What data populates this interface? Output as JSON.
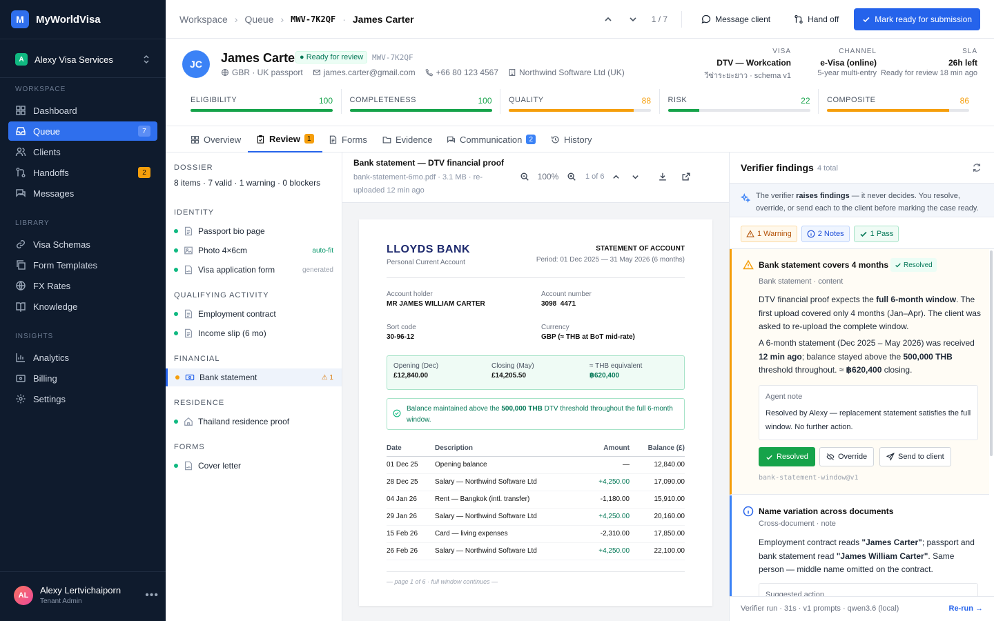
{
  "brand": {
    "logo": "M",
    "name": "MyWorldVisa"
  },
  "tenant": {
    "badge": "A",
    "name": "Alexy Visa Services"
  },
  "sidebar": {
    "workspace_label": "WORKSPACE",
    "workspace": [
      {
        "label": "Dashboard",
        "icon": "dashboard-icon"
      },
      {
        "label": "Queue",
        "icon": "inbox-icon",
        "count": "7"
      },
      {
        "label": "Clients",
        "icon": "users-icon"
      },
      {
        "label": "Handoffs",
        "icon": "handoff-icon",
        "count": "2"
      },
      {
        "label": "Messages",
        "icon": "messages-icon"
      }
    ],
    "library_label": "LIBRARY",
    "library": [
      {
        "label": "Visa Schemas"
      },
      {
        "label": "Form Templates"
      },
      {
        "label": "FX Rates"
      },
      {
        "label": "Knowledge"
      }
    ],
    "insights_label": "INSIGHTS",
    "insights": [
      {
        "label": "Analytics"
      },
      {
        "label": "Billing"
      },
      {
        "label": "Settings"
      }
    ]
  },
  "user": {
    "initials": "AL",
    "name": "Alexy Lertvichaiporn",
    "role": "Tenant Admin",
    "more": "•••"
  },
  "topbar": {
    "crumbs": [
      "Workspace",
      "Queue"
    ],
    "code": "MWV-7K2QF",
    "sep": "·",
    "client": "James Carter",
    "pager": "1 / 7",
    "message": "Message client",
    "handoff": "Hand off",
    "primary": "Mark ready for submission"
  },
  "client": {
    "initials": "JC",
    "name": "James Carter",
    "status": "Ready for review",
    "code": "MWV-7K2QF",
    "nationality": "GBR · UK passport",
    "email": "james.carter@gmail.com",
    "phone": "+66 80 123 4567",
    "employer": "Northwind Software Ltd (UK)",
    "visa": {
      "label": "VISA",
      "v1": "DTV — Workcation",
      "v2": "วีซ่าระยะยาว · schema v1"
    },
    "channel": {
      "label": "CHANNEL",
      "v1": "e-Visa (online)",
      "v2": "5-year multi-entry"
    },
    "sla": {
      "label": "SLA",
      "v1": "26h left",
      "v2": "Ready for review 18 min ago"
    },
    "scores": [
      {
        "label": "ELIGIBILITY",
        "value": 100,
        "color": "#16a34a"
      },
      {
        "label": "COMPLETENESS",
        "value": 100,
        "color": "#16a34a"
      },
      {
        "label": "QUALITY",
        "value": 88,
        "color": "#f59e0b"
      },
      {
        "label": "RISK",
        "value": 22,
        "color": "#16a34a"
      },
      {
        "label": "COMPOSITE",
        "value": 86,
        "color": "#f59e0b"
      }
    ]
  },
  "tabs": [
    {
      "label": "Overview"
    },
    {
      "label": "Review",
      "badge": "1"
    },
    {
      "label": "Forms"
    },
    {
      "label": "Evidence"
    },
    {
      "label": "Communication",
      "badge": "2"
    },
    {
      "label": "History"
    }
  ],
  "dossier": {
    "label": "DOSSIER",
    "summary": "8 items · 7 valid · 1 warning · 0 blockers",
    "groups": [
      {
        "label": "IDENTITY",
        "items": [
          {
            "label": "Passport bio page"
          },
          {
            "label": "Photo 4×6cm",
            "tag": "auto-fit"
          },
          {
            "label": "Visa application form",
            "tag": "generated"
          }
        ]
      },
      {
        "label": "QUALIFYING ACTIVITY",
        "items": [
          {
            "label": "Employment contract"
          },
          {
            "label": "Income slip (6 mo)"
          }
        ]
      },
      {
        "label": "FINANCIAL",
        "items": [
          {
            "label": "Bank statement",
            "tag": "⚠ 1"
          }
        ]
      },
      {
        "label": "RESIDENCE",
        "items": [
          {
            "label": "Thailand residence proof"
          }
        ]
      },
      {
        "label": "FORMS",
        "items": [
          {
            "label": "Cover letter"
          }
        ]
      }
    ]
  },
  "viewer": {
    "title": "Bank statement — DTV financial proof",
    "sub": "bank-statement-6mo.pdf · 3.1 MB · re-uploaded 12 min ago",
    "zoom": "100%",
    "page": "1 of 6",
    "doc": {
      "bank": "LLOYDS BANK",
      "account_type": "Personal Current Account",
      "heading": "STATEMENT OF ACCOUNT",
      "period": "Period: 01 Dec 2025 — 31 May 2026 (6 months)",
      "holder_k": "Account holder",
      "holder_v": "MR JAMES WILLIAM CARTER",
      "number_k": "Account number",
      "number_v": "3098  4471",
      "sort_k": "Sort code",
      "sort_v": "30-96-12",
      "currency_k": "Currency",
      "currency_v": "GBP (≈ THB at BoT mid-rate)",
      "opening_k": "Opening (Dec)",
      "opening_v": "£12,840.00",
      "closing_k": "Closing (May)",
      "closing_v": "£14,205.50",
      "thb_k": "≈ THB equivalent",
      "thb_v": "฿620,400",
      "note_a": "Balance maintained above the ",
      "note_b": "500,000 THB",
      "note_c": " DTV threshold throughout the full 6-month window.",
      "columns": [
        "Date",
        "Description",
        "Amount",
        "Balance (£)"
      ],
      "rows": [
        [
          "01 Dec 25",
          "Opening balance",
          "—",
          "12,840.00"
        ],
        [
          "28 Dec 25",
          "Salary — Northwind Software Ltd",
          "+4,250.00",
          "17,090.00"
        ],
        [
          "04 Jan 26",
          "Rent — Bangkok (intl. transfer)",
          "-1,180.00",
          "15,910.00"
        ],
        [
          "29 Jan 26",
          "Salary — Northwind Software Ltd",
          "+4,250.00",
          "20,160.00"
        ],
        [
          "15 Feb 26",
          "Card — living expenses",
          "-2,310.00",
          "17,850.00"
        ],
        [
          "26 Feb 26",
          "Salary — Northwind Software Ltd",
          "+4,250.00",
          "22,100.00"
        ]
      ],
      "footer": "— page 1 of 6 · full window continues —"
    }
  },
  "findings": {
    "title": "Verifier findings",
    "count": "4 total",
    "info_a": "The verifier ",
    "info_b": "raises findings",
    "info_c": " — it never decides. You resolve, override, or send each to the client before marking the case ready.",
    "chips": {
      "warning": "1 Warning",
      "notes": "2 Notes",
      "pass": "1 Pass"
    },
    "card1": {
      "title": "Bank statement covers 4 months",
      "badge": "Resolved",
      "sub": "Bank statement · content",
      "p1a": "DTV financial proof expects the ",
      "p1b": "full 6-month window",
      "p1c": ". The first upload covered only 4 months (Jan–Apr). The client was asked to re-upload the complete window.",
      "p2a": "A 6-month statement (Dec 2025 – May 2026) was received ",
      "p2b": "12 min ago",
      "p2c": "; balance stayed above the ",
      "p2d": "500,000 THB",
      "p2e": " threshold throughout. ≈ ",
      "p2f": "฿620,400",
      "p2g": " closing.",
      "agent_k": "Agent note",
      "agent_v": "Resolved by Alexy — replacement statement satisfies the full window. No further action.",
      "resolved": "Resolved",
      "override": "Override",
      "send": "Send to client",
      "rule": "bank-statement-window@v1"
    },
    "card2": {
      "title": "Name variation across documents",
      "sub": "Cross-document · note",
      "pa": "Employment contract reads ",
      "pb": "\"James Carter\"",
      "pc": "; passport and bank statement read ",
      "pd": "\"James William Carter\"",
      "pe": ". Same person — middle name omitted on the contract.",
      "sugg_k": "Suggested action"
    },
    "footer": "Verifier run · 31s · v1 prompts · qwen3.6 (local)",
    "rerun": "Re-run →"
  }
}
